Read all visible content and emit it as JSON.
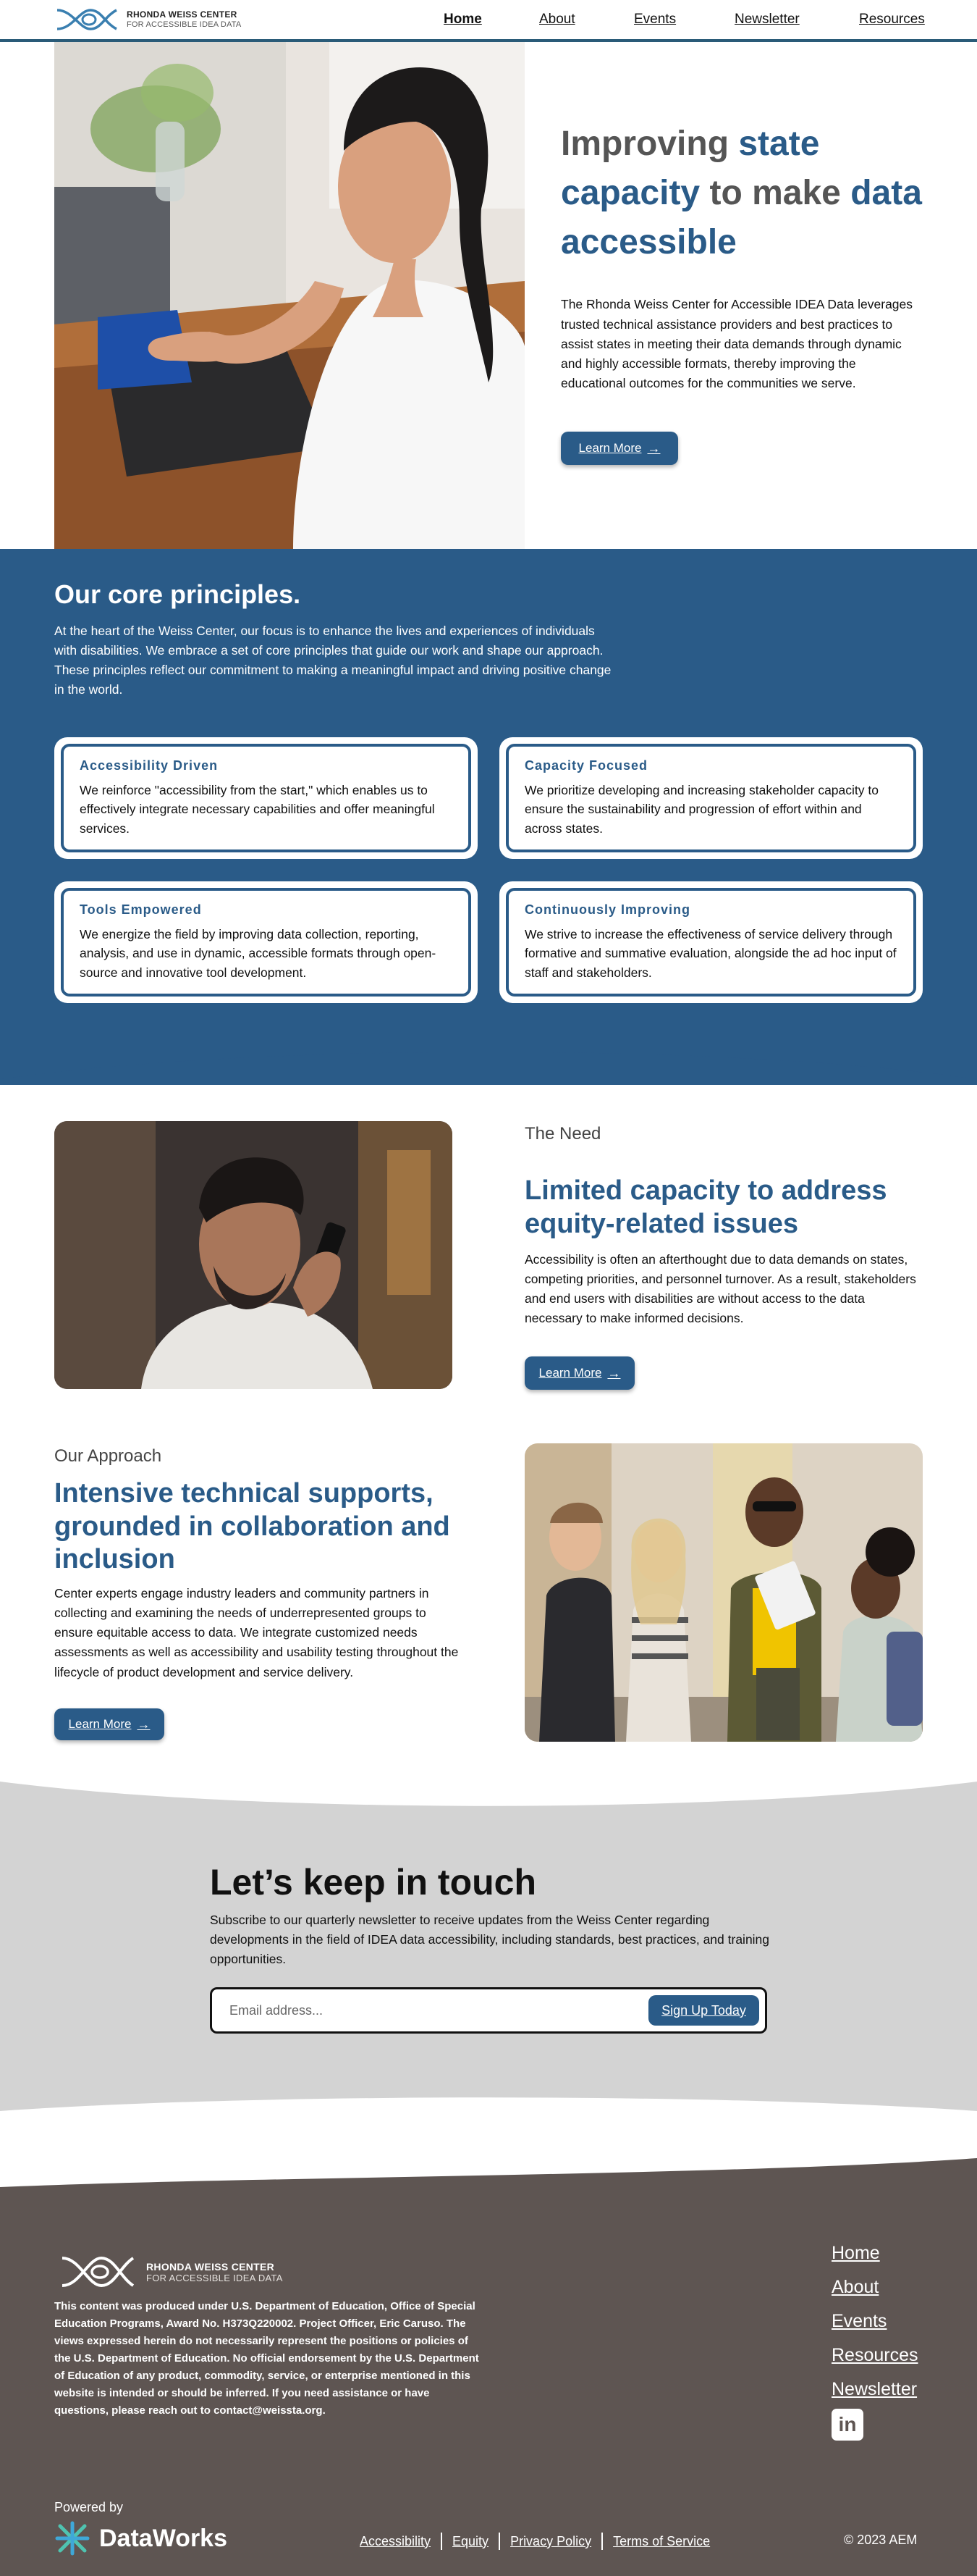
{
  "header": {
    "logo_title": "RHONDA WEISS CENTER",
    "logo_subtitle": "FOR ACCESSIBLE IDEA DATA",
    "nav": [
      "Home",
      "About",
      "Events",
      "Newsletter",
      "Resources"
    ],
    "active_nav": "Home"
  },
  "hero": {
    "title_part1": "Improving ",
    "title_hl1": "state capacity",
    "title_part2": " to make ",
    "title_hl2": "data accessible",
    "body": "The Rhonda Weiss Center for Accessible IDEA Data leverages trusted technical assistance providers and best practices to assist states in meeting their data demands through dynamic and highly accessible formats, thereby improving the educational outcomes for the communities we serve.",
    "button_label": "Learn More"
  },
  "principles": {
    "title": "Our core principles.",
    "intro": "At the heart of the Weiss Center, our focus is to enhance the lives and experiences of individuals with disabilities. We embrace a set of core principles that guide our work and shape our approach. These principles reflect our commitment to making a meaningful impact and driving positive change in the world.",
    "cards": [
      {
        "title": "Accessibility Driven",
        "text": "We reinforce \"accessibility from the start,\" which enables us to effectively integrate necessary capabilities and offer meaningful services."
      },
      {
        "title": "Capacity Focused",
        "text": "We prioritize developing and increasing stakeholder capacity to ensure the sustainability and progression of effort within and across states."
      },
      {
        "title": "Tools Empowered",
        "text": "We energize the field by improving data collection, reporting, analysis, and use in dynamic, accessible formats through open-source and innovative tool development."
      },
      {
        "title": "Continuously Improving",
        "text": "We strive to increase the effectiveness of service delivery through formative and summative evaluation, alongside the ad hoc input of staff and stakeholders."
      }
    ]
  },
  "need": {
    "eyebrow": "The Need",
    "title": "Limited capacity to address equity-related issues",
    "body": "Accessibility is often an afterthought due to data demands on states, competing priorities, and personnel turnover. As a result, stakeholders and end users with disabilities are without access to the data necessary to make informed decisions.",
    "button_label": "Learn More"
  },
  "approach": {
    "eyebrow": "Our Approach",
    "title": "Intensive technical supports, grounded in collaboration and inclusion",
    "body": "Center experts engage industry leaders and community partners in collecting and examining the needs of underrepresented groups to ensure equitable access to data. We integrate customized needs assessments as well as accessibility and usability testing throughout the lifecycle of product development and service delivery.",
    "button_label": "Learn More"
  },
  "newsletter": {
    "title": "Let’s keep in touch",
    "body": "Subscribe to our quarterly newsletter to receive updates from the Weiss Center regarding developments in the field of IDEA data accessibility, including standards, best practices, and training opportunities.",
    "placeholder": "Email address...",
    "button_label": "Sign Up Today"
  },
  "footer": {
    "logo_title": "RHONDA WEISS CENTER",
    "logo_subtitle": "FOR ACCESSIBLE IDEA DATA",
    "disclaimer": "This content was produced under U.S. Department of Education, Office of Special Education Programs, Award No. H373Q220002. Project Officer, Eric Caruso. The views expressed herein do not necessarily represent the positions or policies of the U.S. Department of Education. No official endorsement by the U.S. Department of Education of any product, commodity, service, or enterprise mentioned in this website is intended or should be inferred. If you need assistance or have questions, please reach out to ",
    "contact_email": "contact@weissta.org",
    "nav": [
      "Home",
      "About",
      "Events",
      "Resources",
      "Newsletter"
    ],
    "linkedin_icon": "linkedin-icon",
    "powered_by": "Powered by",
    "dataworks": "DataWorks",
    "links": [
      "Accessibility",
      "Equity",
      "Privacy Policy",
      "Terms of Service"
    ],
    "copyright": "© 2023 AEM"
  },
  "colors": {
    "brand_blue": "#2a5b88",
    "footer_brown": "#5e5552",
    "newsletter_gray": "#d3d3d3"
  }
}
